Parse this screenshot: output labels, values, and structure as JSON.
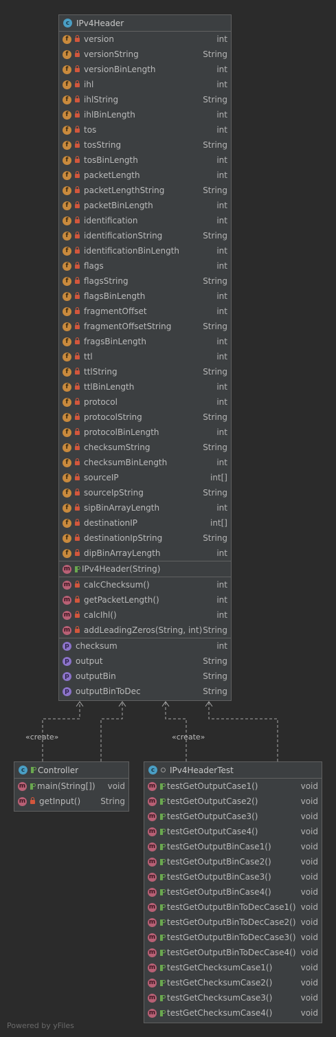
{
  "classes": {
    "ipv4header": {
      "name": "IPv4Header",
      "fields": [
        {
          "name": "version",
          "type": "int"
        },
        {
          "name": "versionString",
          "type": "String"
        },
        {
          "name": "versionBinLength",
          "type": "int"
        },
        {
          "name": "ihl",
          "type": "int"
        },
        {
          "name": "ihlString",
          "type": "String"
        },
        {
          "name": "ihlBinLength",
          "type": "int"
        },
        {
          "name": "tos",
          "type": "int"
        },
        {
          "name": "tosString",
          "type": "String"
        },
        {
          "name": "tosBinLength",
          "type": "int"
        },
        {
          "name": "packetLength",
          "type": "int"
        },
        {
          "name": "packetLengthString",
          "type": "String"
        },
        {
          "name": "packetBinLength",
          "type": "int"
        },
        {
          "name": "identification",
          "type": "int"
        },
        {
          "name": "identificationString",
          "type": "String"
        },
        {
          "name": "identificationBinLength",
          "type": "int"
        },
        {
          "name": "flags",
          "type": "int"
        },
        {
          "name": "flagsString",
          "type": "String"
        },
        {
          "name": "flagsBinLength",
          "type": "int"
        },
        {
          "name": "fragmentOffset",
          "type": "int"
        },
        {
          "name": "fragmentOffsetString",
          "type": "String"
        },
        {
          "name": "fragsBinLength",
          "type": "int"
        },
        {
          "name": "ttl",
          "type": "int"
        },
        {
          "name": "ttlString",
          "type": "String"
        },
        {
          "name": "ttlBinLength",
          "type": "int"
        },
        {
          "name": "protocol",
          "type": "int"
        },
        {
          "name": "protocolString",
          "type": "String"
        },
        {
          "name": "protocolBinLength",
          "type": "int"
        },
        {
          "name": "checksumString",
          "type": "String"
        },
        {
          "name": "checksumBinLength",
          "type": "int"
        },
        {
          "name": "sourceIP",
          "type": "int[]"
        },
        {
          "name": "sourceIpString",
          "type": "String"
        },
        {
          "name": "sipBinArrayLength",
          "type": "int"
        },
        {
          "name": "destinationIP",
          "type": "int[]"
        },
        {
          "name": "destinationIpString",
          "type": "String"
        },
        {
          "name": "dipBinArrayLength",
          "type": "int"
        }
      ],
      "constructors": [
        {
          "name": "IPv4Header(String)",
          "type": ""
        }
      ],
      "methods": [
        {
          "name": "calcChecksum()",
          "type": "int"
        },
        {
          "name": "getPacketLength()",
          "type": "int"
        },
        {
          "name": "calcIhl()",
          "type": "int"
        },
        {
          "name": "addLeadingZeros(String, int)",
          "type": "String"
        }
      ],
      "properties": [
        {
          "name": "checksum",
          "type": "int"
        },
        {
          "name": "output",
          "type": "String"
        },
        {
          "name": "outputBin",
          "type": "String"
        },
        {
          "name": "outputBinToDec",
          "type": "String"
        }
      ]
    },
    "controller": {
      "name": "Controller",
      "methods": [
        {
          "name": "main(String[])",
          "type": "void"
        },
        {
          "name": "getInput()",
          "type": "String"
        }
      ]
    },
    "ipv4headertest": {
      "name": "IPv4HeaderTest",
      "methods": [
        {
          "name": "testGetOutputCase1()",
          "type": "void"
        },
        {
          "name": "testGetOutputCase2()",
          "type": "void"
        },
        {
          "name": "testGetOutputCase3()",
          "type": "void"
        },
        {
          "name": "testGetOutputCase4()",
          "type": "void"
        },
        {
          "name": "testGetOutputBinCase1()",
          "type": "void"
        },
        {
          "name": "testGetOutputBinCase2()",
          "type": "void"
        },
        {
          "name": "testGetOutputBinCase3()",
          "type": "void"
        },
        {
          "name": "testGetOutputBinCase4()",
          "type": "void"
        },
        {
          "name": "testGetOutputBinToDecCase1()",
          "type": "void"
        },
        {
          "name": "testGetOutputBinToDecCase2()",
          "type": "void"
        },
        {
          "name": "testGetOutputBinToDecCase3()",
          "type": "void"
        },
        {
          "name": "testGetOutputBinToDecCase4()",
          "type": "void"
        },
        {
          "name": "testGetChecksumCase1()",
          "type": "void"
        },
        {
          "name": "testGetChecksumCase2()",
          "type": "void"
        },
        {
          "name": "testGetChecksumCase3()",
          "type": "void"
        },
        {
          "name": "testGetChecksumCase4()",
          "type": "void"
        }
      ]
    }
  },
  "edges": {
    "create_label_left": "«create»",
    "create_label_right": "«create»"
  },
  "icons": {
    "class": "class-icon",
    "field": "field-icon",
    "method": "method-icon",
    "property": "property-icon",
    "private": "lock-icon",
    "public": "public-icon"
  },
  "colors": {
    "background": "#2b2b2b",
    "node": "#3c3f41",
    "border": "#616161",
    "edge": "#a9a9a9"
  },
  "footer": "Powered by yFiles"
}
